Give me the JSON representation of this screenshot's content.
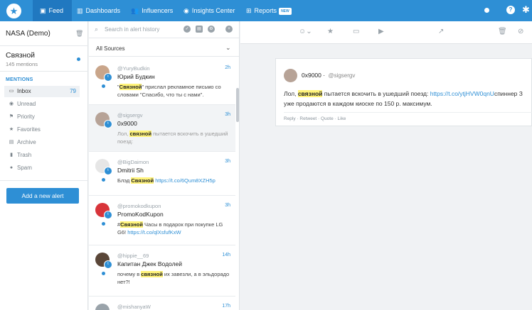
{
  "nav": {
    "items": [
      {
        "label": "Feed",
        "icon": "feed-icon"
      },
      {
        "label": "Dashboards",
        "icon": "bar-chart-icon"
      },
      {
        "label": "Influencers",
        "icon": "users-icon"
      },
      {
        "label": "Insights Center",
        "icon": "compass-icon"
      },
      {
        "label": "Reports",
        "icon": "grid-icon"
      }
    ],
    "badge": "NEW",
    "help": "?"
  },
  "sidebar": {
    "org": "NASA (Demo)",
    "alert_name": "Связной",
    "alert_count": "145 mentions",
    "mentions_heading": "MENTIONS",
    "items": [
      {
        "label": "Inbox",
        "count": "79"
      },
      {
        "label": "Unread"
      },
      {
        "label": "Priority"
      },
      {
        "label": "Favorites"
      },
      {
        "label": "Archive"
      },
      {
        "label": "Trash"
      },
      {
        "label": "Spam"
      }
    ],
    "add_button": "Add a new alert"
  },
  "list": {
    "search_placeholder": "Search in alert history",
    "sources_label": "All Sources",
    "items": [
      {
        "handle": "@YuryBudkin",
        "time": "2h",
        "name": "Юрий Будкин",
        "pre": "\"",
        "hl": "Связной",
        "post": "\" прислал рекламное письмо со словами \"Спасибо, что ты с нами\".",
        "link": "",
        "unread": true
      },
      {
        "handle": "@sigsergv",
        "time": "3h",
        "name": "0x9000",
        "pre": "Лол, ",
        "hl": "связной",
        "post": " пытается вскочить в ушедший поезд:",
        "link": "",
        "unread": false
      },
      {
        "handle": "@BigDaimon",
        "time": "3h",
        "name": "Dmitrii Sh",
        "pre": "Блэд ",
        "hl": "Связной",
        "post": " ",
        "link": "https://t.co/6Qum8XZH5p",
        "unread": true
      },
      {
        "handle": "@promokodkupon",
        "time": "3h",
        "name": "PromoKodKupon",
        "pre": "#",
        "hl": "Связной",
        "post": " Часы в подарок при покупке LG G6! ",
        "link": "https://t.co/qlXsfufKxW",
        "unread": true
      },
      {
        "handle": "@hippie__69",
        "time": "14h",
        "name": "Капитан Джек Водолей",
        "pre": "почему в ",
        "hl": "связной",
        "post": " их завезли, а в эльдорадо нет?!",
        "link": "",
        "unread": true
      },
      {
        "handle": "@mishanyaW",
        "time": "17h",
        "name": "",
        "pre": "",
        "hl": "",
        "post": "",
        "link": "",
        "unread": false
      }
    ]
  },
  "detail": {
    "name": "0x9000",
    "handle": "@sigsergv",
    "line1_pre": "Лол, ",
    "line1_hl": "связной",
    "line1_post": " пытается вскочить в ушедший поезд: ",
    "line1_link": "https://t.co/ytjHVW0qnU",
    "line1_tail": "спиннер З",
    "line2": "уже продаются в каждом киоске по 150 р. максимум.",
    "actions": "Reply · Retweet · Quote · Like"
  },
  "colors": {
    "brand": "#2e8fd5",
    "highlight": "#fff37a"
  }
}
